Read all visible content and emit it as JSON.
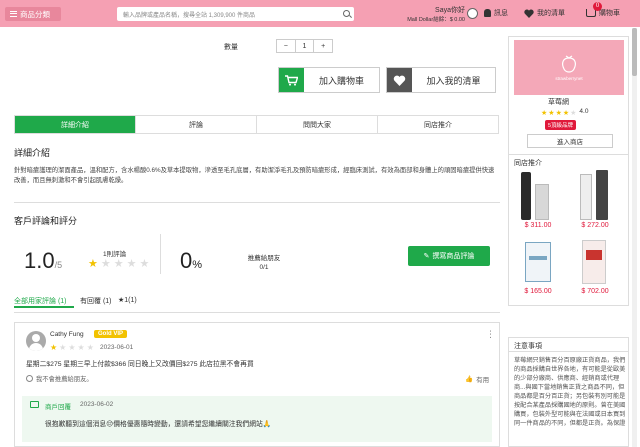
{
  "header": {
    "category_label": "商品分類",
    "search_placeholder": "輸入品牌或產品名稱，搜尋全站 1,309,900 件商品",
    "user_greeting": "Saya你好",
    "mall_dollar": "Mall Dollar結餘：$ 0.00",
    "messages_label": "訊息",
    "wishlist_label": "我的清單",
    "cart_label": "購物車",
    "cart_count": "0"
  },
  "purchase": {
    "quantity_label": "數量",
    "stepper": {
      "minus": "−",
      "value": "1",
      "plus": "+"
    },
    "add_to_cart": "加入購物車",
    "add_to_wishlist": "加入我的清單"
  },
  "tabs": [
    "詳細介紹",
    "評論",
    "問問大家",
    "同店推介"
  ],
  "details": {
    "heading": "詳細介紹",
    "text": "針對暗瘡護理的潔面產品，溫和配方，含水楊酸0.6%及草本提取物，滲透至毛孔底層，有助潔淨毛孔及預防暗瘡形成，經臨床測試，有效為面部和身體上的頑固暗瘡提供快速改善，而且無刺激和不會引起肌膚乾燥。"
  },
  "reviews": {
    "heading": "客戶評論和評分",
    "score": "1.0",
    "score_suffix": "/5",
    "review_count": "1則評論",
    "rating_stars": 1,
    "recommend_pct": "0",
    "recommend_unit": "%",
    "recommend_label": "推薦給朋友",
    "recommend_ratio": "0/1",
    "write_review": "撰寫商品評論",
    "filter_tabs": {
      "all": "全部用家評論 (1)",
      "with_reply": "有回覆 (1)",
      "one_star": "1(1)"
    },
    "items": [
      {
        "name": "Cathy Fung",
        "badge": "Gold VIP",
        "stars": 1,
        "date": "2023-06-01",
        "text": "星期二$275 星期三早上付款$366 同日晚上又改價回$275 此店拉黑不會再買",
        "not_recommend": "我不會推薦給朋友。",
        "helpful": "有用",
        "more": "⋮",
        "reply": {
          "label": "商戶回覆",
          "date": "2023-06-02",
          "text": "很抱歉聽到這個消息😔價格優惠隨時變動，還請希望您繼續關注我們網站🙏"
        }
      }
    ]
  },
  "sidebar": {
    "shop_logo_text": "strawberrynet",
    "shop_name": "草莓網",
    "shop_rating": "4.0",
    "shop_badge": "5頂級品牌",
    "enter_shop": "進入商店",
    "recommend_heading": "同店推介",
    "products": [
      {
        "price": "$ 311.00",
        "color": "#2a2a2a",
        "color2": "#d8d8d8"
      },
      {
        "price": "$ 272.00",
        "color": "#444",
        "color2": "#eeeeee"
      },
      {
        "price": "$ 165.00",
        "color": "#7aa6c2",
        "color2": "#f0f4f8"
      },
      {
        "price": "$ 702.00",
        "color": "#c9342f",
        "color2": "#f7ecea"
      }
    ]
  },
  "notice": {
    "heading": "注意事項",
    "text": "草莓網只銷售百分百原廠正貨商品，我們的商品採購自世界各地，有可能是從歐美的少部分廠商、供應商、經銷商或代理商...與國下當地銷售正貨之商品不同，但商品都是百分百正貨；另包裝有別可能是按配合某產品採購國地的原則。曾在美國購買，包裝外型可能與在法國或日本買到同一件商品的不同，但都是正貨。為保證"
  },
  "colors": {
    "brand_pink": "#f5a0b3",
    "brand_green": "#1fa94a",
    "price_red": "#e0193b",
    "star_gold": "#f2c200"
  }
}
